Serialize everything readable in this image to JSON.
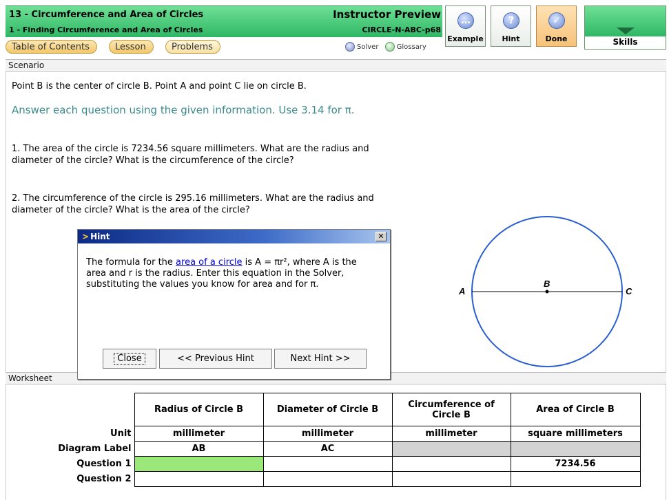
{
  "header": {
    "unit_title": "13 - Circumference and Area of Circles",
    "section_title": "1 - Finding Circumference and Area of Circles",
    "preview_label": "Instructor Preview",
    "problem_code": "CIRCLE-N-ABC-p68",
    "nav_tabs": [
      "Table of Contents",
      "Lesson",
      "Problems"
    ],
    "solver_label": "Solver",
    "glossary_label": "Glossary",
    "buttons": {
      "example": "Example",
      "hint": "Hint",
      "done": "Done",
      "skills": "Skills"
    }
  },
  "scenario": {
    "section_label": "Scenario",
    "intro": "Point B is the center of circle B. Point A and point C lie on circle B.",
    "instruction": "Answer each question using the given information. Use 3.14 for π.",
    "question1": "1. The area of the circle is 7234.56 square millimeters. What are the radius and diameter of the circle? What is the circumference of the circle?",
    "question2": "2. The circumference of the circle is 295.16 millimeters. What are the radius and diameter of the circle? What is the area of the circle?",
    "diagram": {
      "point_a": "A",
      "point_b": "B",
      "point_c": "C"
    }
  },
  "hint_dialog": {
    "title": "Hint",
    "text_before_link": "The formula for the ",
    "link_text": "area of a circle",
    "text_after_link": " is A = πr², where A is the area and r is the radius. Enter this equation in the Solver, substituting the values you know for area and for π.",
    "close_label": "Close",
    "prev_label": "<< Previous Hint",
    "next_label": "Next Hint >>"
  },
  "worksheet": {
    "section_label": "Worksheet",
    "columns": [
      "Radius of Circle B",
      "Diameter of Circle B",
      "Circumference of Circle B",
      "Area of Circle B"
    ],
    "rows": [
      {
        "label": "Unit",
        "cells": [
          "millimeter",
          "millimeter",
          "millimeter",
          "square millimeters"
        ]
      },
      {
        "label": "Diagram Label",
        "cells": [
          "AB",
          "AC",
          "",
          ""
        ]
      },
      {
        "label": "Question 1",
        "cells": [
          "",
          "",
          "",
          "7234.56"
        ]
      },
      {
        "label": "Question 2",
        "cells": [
          "",
          "",
          "",
          ""
        ]
      }
    ]
  },
  "colors": {
    "header_green": "#2fb765",
    "instruction_teal": "#3b8a8a",
    "active_cell": "#9be87a",
    "disabled_cell": "#d3d3d3",
    "circle_blue": "#2a5fd0"
  }
}
